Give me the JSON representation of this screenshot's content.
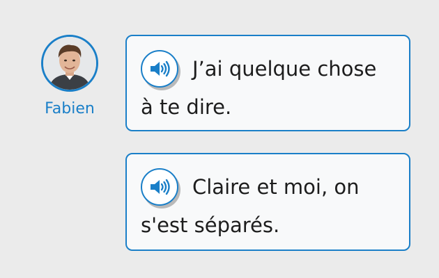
{
  "speaker": {
    "name": "Fabien",
    "avatar_icon": "person-photo-icon"
  },
  "messages": [
    {
      "line1": "J’ai quelque chose",
      "line2": "à te dire.",
      "audio_icon": "speaker-icon"
    },
    {
      "line1": "Claire et moi, on",
      "line2": "s'est séparés.",
      "audio_icon": "speaker-icon"
    }
  ],
  "colors": {
    "accent": "#1a7fc8",
    "background": "#ebebeb",
    "bubble": "#f8f9fa",
    "text": "#1d1d1d"
  }
}
